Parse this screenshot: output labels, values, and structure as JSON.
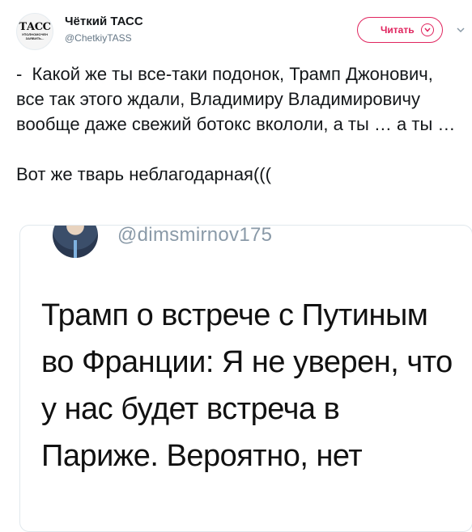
{
  "tweet": {
    "author": {
      "name": "Чёткий ТАСС",
      "handle": "@ChetkiyTASS",
      "avatar_logo": "ТАСС",
      "avatar_sub": "УПОЛНОМОЧЕН ЗАЯВИТЬ..."
    },
    "follow_label": "Читать",
    "text": "-  Какой же ты все-таки подонок, Трамп Джонович, все так этого ждали, Владимиру Владимировичу вообще даже свежий ботокс вкололи, а ты … а ты …\n\nВот же тварь неблагодарная((("
  },
  "quoted": {
    "handle": "@dimsmirnov175",
    "text": "Трамп о встрече с Путиным во Франции: Я не уверен, что у нас будет встреча в Париже. Вероятно, нет"
  },
  "colors": {
    "accent": "#e0245e",
    "muted": "#657786"
  },
  "icons": [
    "chevron-down-icon",
    "caret-down-icon"
  ]
}
